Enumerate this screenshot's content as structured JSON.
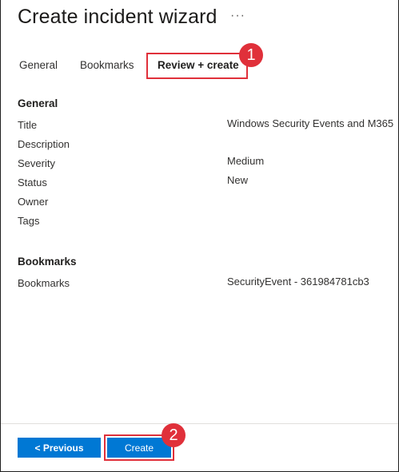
{
  "header": {
    "title": "Create incident wizard",
    "more": "···"
  },
  "tabs": [
    {
      "label": "General"
    },
    {
      "label": "Bookmarks"
    },
    {
      "label": "Review + create"
    }
  ],
  "callouts": {
    "one": "1",
    "two": "2"
  },
  "general": {
    "heading": "General",
    "fields": [
      {
        "label": "Title",
        "value": "Windows Security Events and M365"
      },
      {
        "label": "Description",
        "value": ""
      },
      {
        "label": "Severity",
        "value": "Medium"
      },
      {
        "label": "Status",
        "value": "New"
      },
      {
        "label": "Owner",
        "value": ""
      },
      {
        "label": "Tags",
        "value": ""
      }
    ]
  },
  "bookmarks": {
    "heading": "Bookmarks",
    "fields": [
      {
        "label": "Bookmarks",
        "value": "SecurityEvent - 361984781cb3"
      }
    ]
  },
  "footer": {
    "previous_label": "< Previous",
    "create_label": "Create"
  },
  "colors": {
    "accent": "#0078d4",
    "highlight": "#e0303a"
  }
}
